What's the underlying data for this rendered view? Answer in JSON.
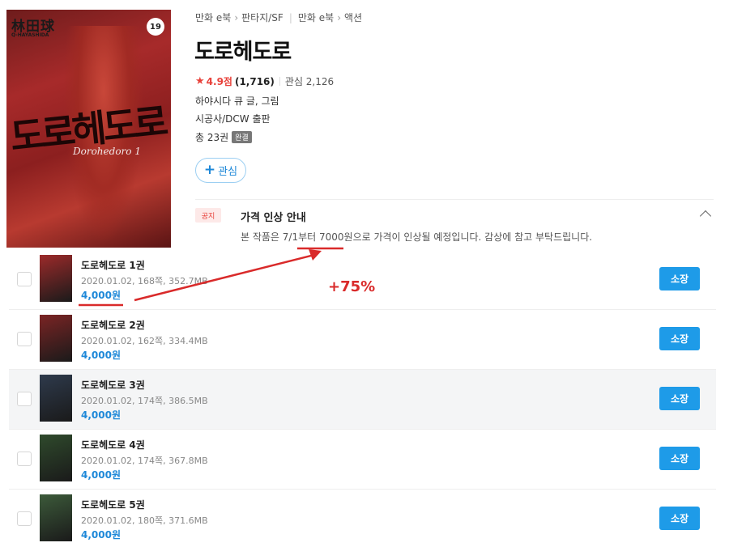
{
  "cover": {
    "badge": "19",
    "author_jp": "林田球",
    "author_en": "Q-HAYASHIDA",
    "logo_ko": "도로헤도로",
    "logo_en": "Dorohedoro 1"
  },
  "breadcrumb": {
    "part1": "만화 e북",
    "part2": "판타지/SF",
    "part3": "만화 e북",
    "part4": "액션"
  },
  "title": "도로헤도로",
  "rating": {
    "score": "4.9점",
    "count": "(1,716)",
    "favorites": "관심 2,126"
  },
  "author_line": "하야시다 큐 글, 그림",
  "publisher_line": "시공사/DCW 출판",
  "total": "총 23권",
  "status_badge": "완결",
  "fav_button": "관심",
  "notice": {
    "tag": "공지",
    "title": "가격 인상 안내",
    "body": "본 작품은 7/1부터 7000원으로 가격이 인상될 예정입니다. 감상에 참고 부탁드립니다."
  },
  "annotation": {
    "text": "+75%",
    "color": "#d92a2a"
  },
  "volumes": [
    {
      "title": "도로헤도로 1권",
      "meta": "2020.01.02, 168쪽, 352.7MB",
      "price": "4,000원",
      "button": "소장",
      "thumb": "#9c2a2a"
    },
    {
      "title": "도로헤도로 2권",
      "meta": "2020.01.02, 162쪽, 334.4MB",
      "price": "4,000원",
      "button": "소장",
      "thumb": "#7b2424"
    },
    {
      "title": "도로헤도로 3권",
      "meta": "2020.01.02, 174쪽, 386.5MB",
      "price": "4,000원",
      "button": "소장",
      "thumb": "#2e3a4c"
    },
    {
      "title": "도로헤도로 4권",
      "meta": "2020.01.02, 174쪽, 367.8MB",
      "price": "4,000원",
      "button": "소장",
      "thumb": "#2f4a2c"
    },
    {
      "title": "도로헤도로 5권",
      "meta": "2020.01.02, 180쪽, 371.6MB",
      "price": "4,000원",
      "button": "소장",
      "thumb": "#3c5a3a"
    }
  ],
  "colors": {
    "accent": "#1e9be8",
    "price": "#1e88d8",
    "rating": "#e8413a"
  }
}
